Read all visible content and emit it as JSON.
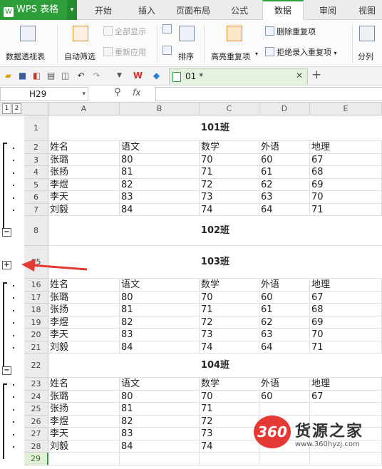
{
  "app": {
    "name": "WPS 表格"
  },
  "tabs": [
    "开始",
    "插入",
    "页面布局",
    "公式",
    "数据",
    "审阅",
    "视图"
  ],
  "active_tab": "数据",
  "ribbon": {
    "pivot": "数据透视表",
    "autofilter": "自动筛选",
    "show_all": "全部显示",
    "reapply": "重新应用",
    "sort": "排序",
    "highlight_dup": "高亮重复项",
    "remove_dup": "删除重复项",
    "reject_dup": "拒绝录入重复项",
    "split": "分列"
  },
  "document": {
    "tab_name": "01 *"
  },
  "formula_bar": {
    "name_box": "H29",
    "fx": "fx",
    "content": ""
  },
  "outline_levels": [
    "1",
    "2"
  ],
  "columns": [
    "A",
    "B",
    "C",
    "D",
    "E"
  ],
  "rows": [
    {
      "n": "1",
      "merged": "101班"
    },
    {
      "n": "2",
      "cells": [
        "姓名",
        "语文",
        "数学",
        "外语",
        "地理"
      ]
    },
    {
      "n": "3",
      "cells": [
        "张璐",
        "80",
        "70",
        "60",
        "67"
      ]
    },
    {
      "n": "4",
      "cells": [
        "张扬",
        "81",
        "71",
        "61",
        "68"
      ]
    },
    {
      "n": "5",
      "cells": [
        "李煜",
        "82",
        "72",
        "62",
        "69"
      ]
    },
    {
      "n": "6",
      "cells": [
        "李天",
        "83",
        "73",
        "63",
        "70"
      ]
    },
    {
      "n": "7",
      "cells": [
        "刘毅",
        "84",
        "74",
        "64",
        "71"
      ]
    },
    {
      "n": "8",
      "merged": "102班"
    },
    {
      "n": "15",
      "merged": "103班"
    },
    {
      "n": "16",
      "cells": [
        "姓名",
        "语文",
        "数学",
        "外语",
        "地理"
      ]
    },
    {
      "n": "17",
      "cells": [
        "张璐",
        "80",
        "70",
        "60",
        "67"
      ]
    },
    {
      "n": "18",
      "cells": [
        "张扬",
        "81",
        "71",
        "61",
        "68"
      ]
    },
    {
      "n": "19",
      "cells": [
        "李煜",
        "82",
        "72",
        "62",
        "69"
      ]
    },
    {
      "n": "20",
      "cells": [
        "李天",
        "83",
        "73",
        "63",
        "70"
      ]
    },
    {
      "n": "21",
      "cells": [
        "刘毅",
        "84",
        "74",
        "64",
        "71"
      ]
    },
    {
      "n": "22",
      "merged": "104班"
    },
    {
      "n": "23",
      "cells": [
        "姓名",
        "语文",
        "数学",
        "外语",
        "地理"
      ]
    },
    {
      "n": "24",
      "cells": [
        "张璐",
        "80",
        "70",
        "60",
        "67"
      ]
    },
    {
      "n": "25",
      "cells": [
        "张扬",
        "81",
        "71",
        "",
        ""
      ]
    },
    {
      "n": "26",
      "cells": [
        "李煜",
        "82",
        "72",
        "",
        ""
      ]
    },
    {
      "n": "27",
      "cells": [
        "李天",
        "83",
        "73",
        "",
        ""
      ]
    },
    {
      "n": "28",
      "cells": [
        "刘毅",
        "84",
        "74",
        "",
        ""
      ]
    },
    {
      "n": "29",
      "cells": [
        "",
        "",
        "",
        "",
        ""
      ]
    }
  ],
  "outline_buttons": {
    "collapse": "−",
    "expand": "+"
  },
  "watermark": {
    "badge": "360",
    "name": "货源之家",
    "url": "www.360hyzj.com"
  },
  "colors": {
    "accent": "#2e9e3a",
    "arrow": "#e53935"
  }
}
